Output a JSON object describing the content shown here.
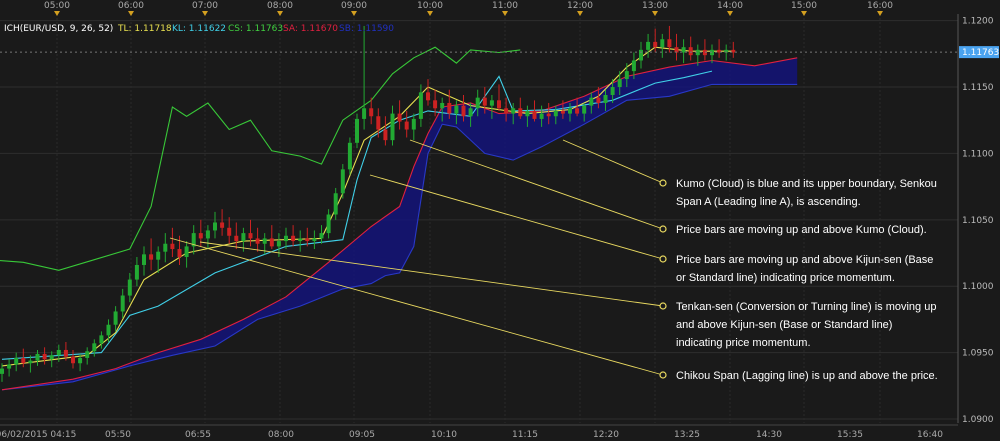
{
  "chart_data": {
    "type": "candlestick",
    "indicator_label": "ICH(EUR/USD, 9, 26, 52)",
    "legend": [
      {
        "key": "TL",
        "text": "TL: 1.11718",
        "color": "#e8e050"
      },
      {
        "key": "KL",
        "text": "KL: 1.11622",
        "color": "#40d0e8"
      },
      {
        "key": "CS",
        "text": "CS: 1.11763",
        "color": "#40d040"
      },
      {
        "key": "SA",
        "text": "SA: 1.11670",
        "color": "#e02040"
      },
      {
        "key": "SB",
        "text": "SB: 1.11590",
        "color": "#2030c0"
      }
    ],
    "last_price": "1.11763",
    "y_ticks": [
      "1.1200",
      "1.1150",
      "1.1100",
      "1.1050",
      "1.1000",
      "1.0950",
      "1.0900"
    ],
    "y_range": [
      1.0897,
      1.1205
    ],
    "top_time_labels": [
      "05:00",
      "06:00",
      "07:00",
      "08:00",
      "09:00",
      "10:00",
      "11:00",
      "12:00",
      "13:00",
      "14:00",
      "15:00",
      "16:00"
    ],
    "bottom_time_labels": [
      "06/02/2015 04:15",
      "05:50",
      "06:55",
      "08:00",
      "09:05",
      "10:10",
      "11:15",
      "12:20",
      "13:25",
      "14:30",
      "15:35",
      "16:40"
    ],
    "candles": [
      [
        1.0934,
        1.0942,
        1.0928,
        1.0938
      ],
      [
        1.0938,
        1.0945,
        1.0932,
        1.0941
      ],
      [
        1.0941,
        1.095,
        1.0936,
        1.0946
      ],
      [
        1.0946,
        1.0953,
        1.0939,
        1.0942
      ],
      [
        1.0942,
        1.0948,
        1.0935,
        1.0944
      ],
      [
        1.0944,
        1.0952,
        1.094,
        1.0949
      ],
      [
        1.0949,
        1.0954,
        1.0941,
        1.0945
      ],
      [
        1.0945,
        1.0951,
        1.0939,
        1.0948
      ],
      [
        1.0948,
        1.0956,
        1.0943,
        1.0952
      ],
      [
        1.0952,
        1.0958,
        1.0944,
        1.0947
      ],
      [
        1.0947,
        1.0952,
        1.0938,
        1.0942
      ],
      [
        1.0942,
        1.0949,
        1.0936,
        1.0946
      ],
      [
        1.0946,
        1.0954,
        1.0941,
        1.0951
      ],
      [
        1.0951,
        1.096,
        1.0947,
        1.0957
      ],
      [
        1.0957,
        1.0966,
        1.0953,
        1.0963
      ],
      [
        1.0963,
        1.0975,
        1.0958,
        1.0971
      ],
      [
        1.0971,
        1.0985,
        1.0966,
        1.0981
      ],
      [
        1.0981,
        1.0998,
        1.0976,
        1.0993
      ],
      [
        1.0993,
        1.101,
        1.0988,
        1.1005
      ],
      [
        1.1005,
        1.1022,
        1.1,
        1.1016
      ],
      [
        1.1016,
        1.103,
        1.1008,
        1.1024
      ],
      [
        1.1024,
        1.1036,
        1.1012,
        1.102
      ],
      [
        1.102,
        1.103,
        1.101,
        1.1026
      ],
      [
        1.1026,
        1.104,
        1.1018,
        1.1032
      ],
      [
        1.1032,
        1.1044,
        1.1022,
        1.1028
      ],
      [
        1.1028,
        1.1038,
        1.1016,
        1.1022
      ],
      [
        1.1022,
        1.1034,
        1.1014,
        1.103
      ],
      [
        1.103,
        1.1046,
        1.1024,
        1.104
      ],
      [
        1.104,
        1.105,
        1.103,
        1.1036
      ],
      [
        1.1036,
        1.1046,
        1.1028,
        1.1042
      ],
      [
        1.1042,
        1.1056,
        1.1036,
        1.1048
      ],
      [
        1.1048,
        1.1058,
        1.1038,
        1.1044
      ],
      [
        1.1044,
        1.1052,
        1.1032,
        1.1038
      ],
      [
        1.1038,
        1.1048,
        1.1028,
        1.1034
      ],
      [
        1.1034,
        1.1044,
        1.1026,
        1.104
      ],
      [
        1.104,
        1.105,
        1.103,
        1.1036
      ],
      [
        1.1036,
        1.1044,
        1.1026,
        1.1032
      ],
      [
        1.1032,
        1.104,
        1.1024,
        1.1036
      ],
      [
        1.1036,
        1.1046,
        1.1028,
        1.103
      ],
      [
        1.103,
        1.104,
        1.1022,
        1.1034
      ],
      [
        1.1034,
        1.1044,
        1.1028,
        1.1038
      ],
      [
        1.1038,
        1.1046,
        1.103,
        1.1034
      ],
      [
        1.1034,
        1.1042,
        1.1026,
        1.1036
      ],
      [
        1.1036,
        1.1044,
        1.103,
        1.1034
      ],
      [
        1.1034,
        1.1042,
        1.1028,
        1.1036
      ],
      [
        1.1036,
        1.1046,
        1.1032,
        1.104
      ],
      [
        1.104,
        1.1058,
        1.1036,
        1.1054
      ],
      [
        1.1054,
        1.1074,
        1.105,
        1.107
      ],
      [
        1.107,
        1.1092,
        1.1066,
        1.1088
      ],
      [
        1.1088,
        1.1112,
        1.1084,
        1.1108
      ],
      [
        1.1108,
        1.113,
        1.1104,
        1.1126
      ],
      [
        1.1126,
        1.1196,
        1.1118,
        1.1134
      ],
      [
        1.1134,
        1.1142,
        1.1122,
        1.1128
      ],
      [
        1.1128,
        1.1134,
        1.1112,
        1.1118
      ],
      [
        1.1118,
        1.1128,
        1.1106,
        1.111
      ],
      [
        1.111,
        1.1136,
        1.1106,
        1.113
      ],
      [
        1.113,
        1.114,
        1.1118,
        1.1124
      ],
      [
        1.1124,
        1.1132,
        1.1112,
        1.1118
      ],
      [
        1.1118,
        1.113,
        1.111,
        1.1126
      ],
      [
        1.1126,
        1.1152,
        1.112,
        1.1146
      ],
      [
        1.1146,
        1.1156,
        1.1136,
        1.114
      ],
      [
        1.114,
        1.1148,
        1.1128,
        1.1134
      ],
      [
        1.1134,
        1.1142,
        1.1124,
        1.1138
      ],
      [
        1.1138,
        1.1148,
        1.1126,
        1.113
      ],
      [
        1.113,
        1.114,
        1.1122,
        1.1136
      ],
      [
        1.1136,
        1.1144,
        1.1124,
        1.1128
      ],
      [
        1.1128,
        1.1138,
        1.112,
        1.1134
      ],
      [
        1.1134,
        1.1148,
        1.1128,
        1.1142
      ],
      [
        1.1142,
        1.115,
        1.113,
        1.1136
      ],
      [
        1.1136,
        1.1144,
        1.1126,
        1.114
      ],
      [
        1.114,
        1.1152,
        1.1132,
        1.1134
      ],
      [
        1.1134,
        1.1142,
        1.1124,
        1.113
      ],
      [
        1.113,
        1.1138,
        1.1122,
        1.1134
      ],
      [
        1.1134,
        1.1142,
        1.1126,
        1.1128
      ],
      [
        1.1128,
        1.1136,
        1.112,
        1.1132
      ],
      [
        1.1132,
        1.114,
        1.1124,
        1.1126
      ],
      [
        1.1126,
        1.1136,
        1.112,
        1.113
      ],
      [
        1.113,
        1.1138,
        1.1122,
        1.1128
      ],
      [
        1.1128,
        1.1136,
        1.1122,
        1.1132
      ],
      [
        1.1132,
        1.114,
        1.1126,
        1.113
      ],
      [
        1.113,
        1.1138,
        1.1124,
        1.1134
      ],
      [
        1.1134,
        1.1142,
        1.1128,
        1.113
      ],
      [
        1.113,
        1.1138,
        1.1124,
        1.1136
      ],
      [
        1.1136,
        1.1146,
        1.113,
        1.1142
      ],
      [
        1.1142,
        1.115,
        1.1134,
        1.1138
      ],
      [
        1.1138,
        1.1148,
        1.1132,
        1.1144
      ],
      [
        1.1144,
        1.1156,
        1.1138,
        1.115
      ],
      [
        1.115,
        1.1162,
        1.1144,
        1.1156
      ],
      [
        1.1156,
        1.1168,
        1.115,
        1.1162
      ],
      [
        1.1162,
        1.1176,
        1.1156,
        1.117
      ],
      [
        1.117,
        1.1184,
        1.1164,
        1.1178
      ],
      [
        1.1178,
        1.119,
        1.1172,
        1.1184
      ],
      [
        1.1184,
        1.1194,
        1.1176,
        1.118
      ],
      [
        1.118,
        1.119,
        1.1172,
        1.1186
      ],
      [
        1.1186,
        1.1196,
        1.1176,
        1.118
      ],
      [
        1.118,
        1.119,
        1.117,
        1.1176
      ],
      [
        1.1176,
        1.1186,
        1.1168,
        1.118
      ],
      [
        1.118,
        1.1188,
        1.117,
        1.1174
      ],
      [
        1.1174,
        1.1182,
        1.1166,
        1.1178
      ],
      [
        1.1178,
        1.1186,
        1.117,
        1.1174
      ],
      [
        1.1174,
        1.1182,
        1.1168,
        1.1178
      ],
      [
        1.1178,
        1.1186,
        1.1172,
        1.1176
      ],
      [
        1.1176,
        1.1182,
        1.117,
        1.1178
      ],
      [
        1.1178,
        1.1184,
        1.1172,
        1.1176
      ]
    ],
    "tenkan": [
      [
        0,
        1.094
      ],
      [
        12,
        1.0948
      ],
      [
        16,
        1.0965
      ],
      [
        20,
        1.1005
      ],
      [
        26,
        1.1025
      ],
      [
        34,
        1.1034
      ],
      [
        45,
        1.1036
      ],
      [
        48,
        1.107
      ],
      [
        51,
        1.111
      ],
      [
        56,
        1.1128
      ],
      [
        60,
        1.115
      ],
      [
        66,
        1.1136
      ],
      [
        74,
        1.113
      ],
      [
        80,
        1.1133
      ],
      [
        84,
        1.1143
      ],
      [
        88,
        1.1165
      ],
      [
        92,
        1.118
      ],
      [
        97,
        1.1177
      ],
      [
        103,
        1.1177
      ]
    ],
    "kijun": [
      [
        0,
        1.0945
      ],
      [
        14,
        1.095
      ],
      [
        18,
        1.0978
      ],
      [
        22,
        1.0985
      ],
      [
        30,
        1.101
      ],
      [
        40,
        1.103
      ],
      [
        48,
        1.1035
      ],
      [
        50,
        1.108
      ],
      [
        52,
        1.1112
      ],
      [
        56,
        1.1125
      ],
      [
        60,
        1.1132
      ],
      [
        66,
        1.1128
      ],
      [
        70,
        1.1158
      ],
      [
        72,
        1.1132
      ],
      [
        78,
        1.1133
      ],
      [
        86,
        1.114
      ],
      [
        92,
        1.1153
      ],
      [
        96,
        1.1157
      ],
      [
        100,
        1.1162
      ]
    ],
    "chikou": [
      [
        -2,
        1.102
      ],
      [
        3,
        1.1018
      ],
      [
        8,
        1.1012
      ],
      [
        13,
        1.102
      ],
      [
        18,
        1.1028
      ],
      [
        21,
        1.106
      ],
      [
        24,
        1.1135
      ],
      [
        26,
        1.1128
      ],
      [
        29,
        1.1138
      ],
      [
        32,
        1.1118
      ],
      [
        35,
        1.1125
      ],
      [
        38,
        1.1102
      ],
      [
        42,
        1.1098
      ],
      [
        45,
        1.1092
      ],
      [
        48,
        1.1125
      ],
      [
        52,
        1.114
      ],
      [
        55,
        1.116
      ],
      [
        58,
        1.1172
      ],
      [
        61,
        1.118
      ],
      [
        64,
        1.1168
      ],
      [
        66,
        1.1178
      ],
      [
        70,
        1.1176
      ],
      [
        73,
        1.1178
      ]
    ],
    "senkou_a": [
      [
        0,
        1.0922
      ],
      [
        10,
        1.093
      ],
      [
        16,
        1.0938
      ],
      [
        22,
        1.095
      ],
      [
        28,
        1.096
      ],
      [
        34,
        1.0975
      ],
      [
        40,
        1.0992
      ],
      [
        46,
        1.1018
      ],
      [
        52,
        1.1045
      ],
      [
        56,
        1.106
      ],
      [
        58,
        1.109
      ],
      [
        60,
        1.1115
      ],
      [
        62,
        1.1135
      ],
      [
        66,
        1.1138
      ],
      [
        70,
        1.113
      ],
      [
        76,
        1.1132
      ],
      [
        82,
        1.1143
      ],
      [
        88,
        1.1158
      ],
      [
        94,
        1.1165
      ],
      [
        100,
        1.117
      ],
      [
        106,
        1.1166
      ],
      [
        112,
        1.1172
      ]
    ],
    "senkou_b": [
      [
        0,
        1.0922
      ],
      [
        10,
        1.0928
      ],
      [
        18,
        1.094
      ],
      [
        24,
        1.0948
      ],
      [
        30,
        1.0955
      ],
      [
        36,
        1.0975
      ],
      [
        42,
        1.0985
      ],
      [
        48,
        1.0998
      ],
      [
        52,
        1.1002
      ],
      [
        54,
        1.1008
      ],
      [
        56,
        1.101
      ],
      [
        58,
        1.103
      ],
      [
        60,
        1.11
      ],
      [
        62,
        1.1122
      ],
      [
        64,
        1.112
      ],
      [
        68,
        1.11
      ],
      [
        72,
        1.1095
      ],
      [
        76,
        1.1105
      ],
      [
        82,
        1.1122
      ],
      [
        88,
        1.114
      ],
      [
        94,
        1.1143
      ],
      [
        100,
        1.1152
      ],
      [
        106,
        1.1152
      ],
      [
        112,
        1.1152
      ]
    ],
    "annotations": [
      {
        "lines": [
          "Kumo (Cloud) is blue and its upper boundary, Senkou",
          "Span A (Leading line A), is ascending."
        ]
      },
      {
        "lines": [
          "Price bars are moving up and above Kumo (Cloud)."
        ]
      },
      {
        "lines": [
          "Price bars are moving up and above Kijun-sen (Base",
          "or Standard line) indicating price momentum."
        ]
      },
      {
        "lines": [
          "Tenkan-sen (Conversion or Turning line) is moving up",
          "and above Kijun-sen (Base or Standard line)",
          "indicating price momentum."
        ]
      },
      {
        "lines": [
          "Chikou Span (Lagging line) is up and above the price."
        ]
      }
    ],
    "colors": {
      "bg": "#1a1a1a",
      "grid": "#333333",
      "up": "#22aa33",
      "down": "#cc2222",
      "cloud": "#14147a",
      "pointer": "#e8d860",
      "price_tag": "#4aa3f0"
    }
  }
}
